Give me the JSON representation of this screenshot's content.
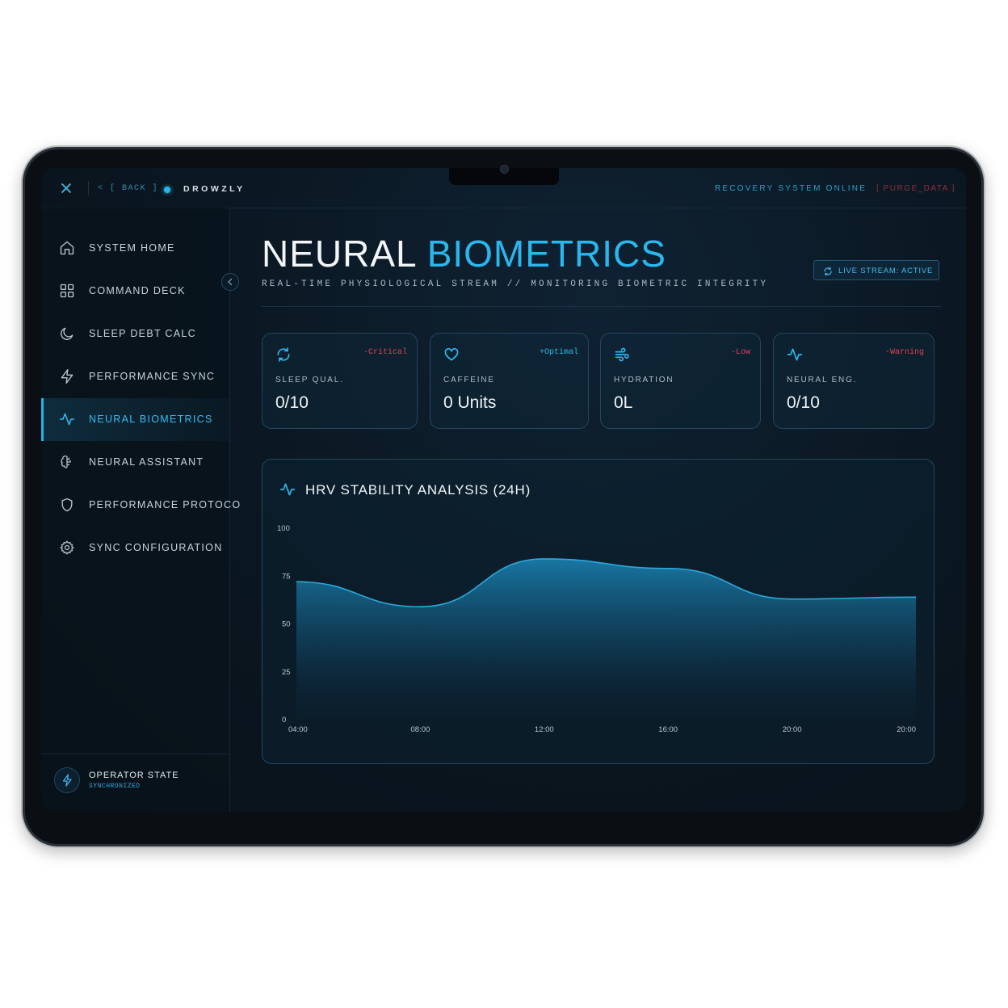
{
  "app": {
    "brand": "DROWZLY",
    "back_label": "< [ BACK ]",
    "status": "RECOVERY SYSTEM ONLINE",
    "purge": "[ PURGE_DATA ]"
  },
  "sidebar": {
    "items": [
      {
        "label": "SYSTEM HOME",
        "icon": "home-icon",
        "active": false
      },
      {
        "label": "COMMAND DECK",
        "icon": "grid-icon",
        "active": false
      },
      {
        "label": "SLEEP DEBT CALC",
        "icon": "moon-icon",
        "active": false
      },
      {
        "label": "PERFORMANCE SYNC",
        "icon": "bolt-icon",
        "active": false
      },
      {
        "label": "NEURAL BIOMETRICS",
        "icon": "activity-icon",
        "active": true
      },
      {
        "label": "NEURAL ASSISTANT",
        "icon": "brain-icon",
        "active": false
      },
      {
        "label": "PERFORMANCE PROTOCO",
        "icon": "shield-icon",
        "active": false
      },
      {
        "label": "SYNC CONFIGURATION",
        "icon": "gear-icon",
        "active": false
      }
    ],
    "operator": {
      "title": "OPERATOR STATE",
      "status": "SYNCHRONIZED"
    }
  },
  "header": {
    "title_main": "NEURAL ",
    "title_accent": "BIOMETRICS",
    "subtitle": "REAL-TIME PHYSIOLOGICAL STREAM // MONITORING BIOMETRIC INTEGRITY",
    "live_label": "LIVE STREAM: ACTIVE"
  },
  "cards": [
    {
      "label": "SLEEP QUAL.",
      "value": "0/10",
      "tag": "-Critical",
      "tag_color": "#e0424f",
      "icon": "refresh-icon"
    },
    {
      "label": "CAFFEINE",
      "value": "0 Units",
      "tag": "+Optimal",
      "tag_color": "#2fb8ee",
      "icon": "heart-icon"
    },
    {
      "label": "HYDRATION",
      "value": "0L",
      "tag": "-Low",
      "tag_color": "#e0424f",
      "icon": "wind-icon"
    },
    {
      "label": "NEURAL ENG.",
      "value": "0/10",
      "tag": "-Warning",
      "tag_color": "#e0424f",
      "icon": "activity-icon"
    }
  ],
  "colors": {
    "accent": "#2ab7ee",
    "critical": "#e0424f"
  },
  "chart": {
    "title": "HRV STABILITY ANALYSIS (24H)"
  },
  "chart_data": {
    "type": "area",
    "title": "HRV STABILITY ANALYSIS (24H)",
    "x": [
      "04:00",
      "08:00",
      "12:00",
      "16:00",
      "20:00",
      "20:00"
    ],
    "series": [
      {
        "values": [
          72,
          59,
          84,
          79,
          63,
          64
        ]
      }
    ],
    "ylim": [
      0,
      100
    ],
    "yticks": [
      0,
      25,
      50,
      75,
      100
    ],
    "grid": false
  }
}
